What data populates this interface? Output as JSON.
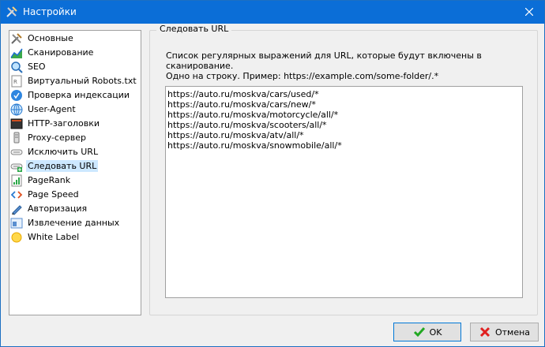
{
  "window": {
    "title": "Настройки"
  },
  "sidebar": {
    "items": [
      {
        "label": "Основные",
        "icon": "tools-icon"
      },
      {
        "label": "Сканирование",
        "icon": "chart-icon"
      },
      {
        "label": "SEO",
        "icon": "magnifier-icon"
      },
      {
        "label": "Виртуальный Robots.txt",
        "icon": "robots-file-icon"
      },
      {
        "label": "Проверка индексации",
        "icon": "globe-check-icon"
      },
      {
        "label": "User-Agent",
        "icon": "globe-icon"
      },
      {
        "label": "HTTP-заголовки",
        "icon": "terminal-icon"
      },
      {
        "label": "Proxy-сервер",
        "icon": "proxy-icon"
      },
      {
        "label": "Исключить URL",
        "icon": "exclude-url-icon"
      },
      {
        "label": "Следовать URL",
        "icon": "follow-url-icon"
      },
      {
        "label": "PageRank",
        "icon": "pagerank-icon"
      },
      {
        "label": "Page Speed",
        "icon": "code-icon"
      },
      {
        "label": "Авторизация",
        "icon": "pen-icon"
      },
      {
        "label": "Извлечение данных",
        "icon": "extract-icon"
      },
      {
        "label": "White Label",
        "icon": "sun-icon"
      }
    ],
    "selected_index": 9
  },
  "panel": {
    "group_title": "Следовать URL",
    "description_line1": "Список регулярных выражений для URL, которые будут включены в сканирование.",
    "description_line2": "Одно на строку. Пример: https://example.com/some-folder/.*",
    "textarea_lines": [
      "https://auto.ru/moskva/cars/used/*",
      "https://auto.ru/moskva/cars/new/*",
      "https://auto.ru/moskva/motorcycle/all/*",
      "https://auto.ru/moskva/scooters/all/*",
      "https://auto.ru/moskva/atv/all/*",
      "https://auto.ru/moskva/snowmobile/all/*"
    ]
  },
  "buttons": {
    "ok_label": "OK",
    "cancel_label": "Отмена"
  },
  "colors": {
    "titlebar": "#0b6ed7",
    "selection": "#cde8ff",
    "ok_check": "#22a822",
    "cancel_x": "#e02020"
  }
}
